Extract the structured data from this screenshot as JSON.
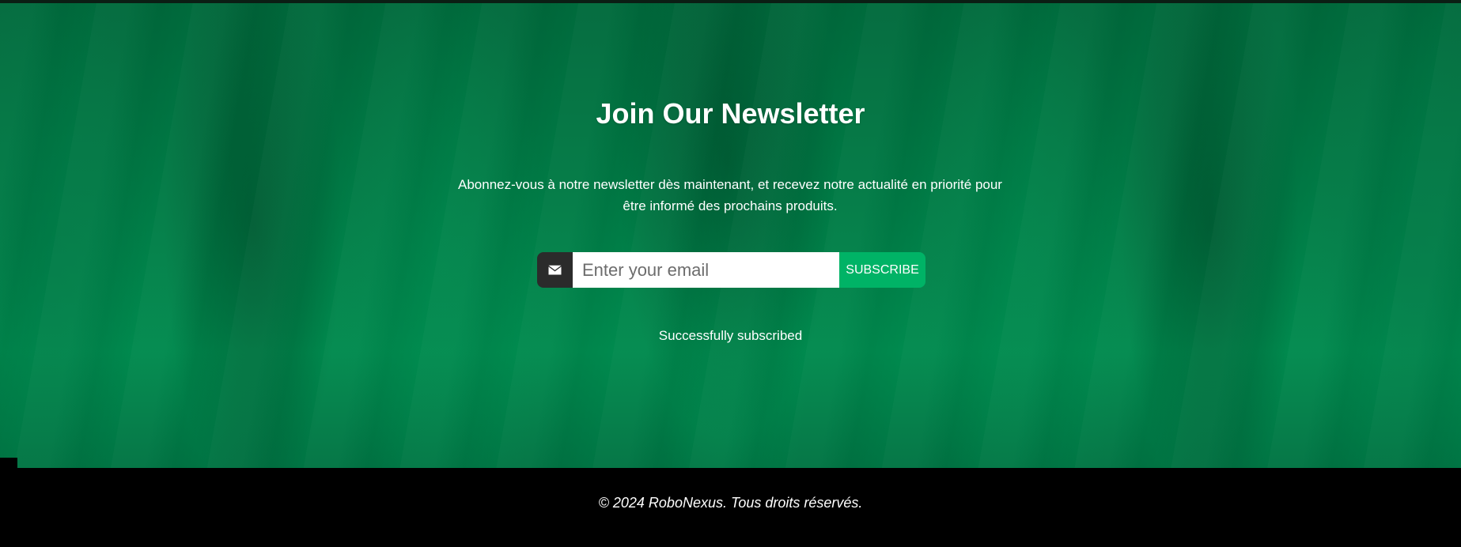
{
  "newsletter": {
    "title": "Join Our Newsletter",
    "description": "Abonnez-vous à notre newsletter dès maintenant, et recevez notre actualité en priorité pour être informé des prochains produits.",
    "email_placeholder": "Enter your email",
    "email_value": "",
    "subscribe_label": "SUBSCRIBE",
    "status_message": "Successfully subscribed",
    "icon": "envelope-icon"
  },
  "footer": {
    "copyright": "© 2024 RoboNexus. Tous droits réservés."
  },
  "colors": {
    "background_green": "#007a45",
    "subscribe_button": "#00b366",
    "icon_box": "#2b2b2b",
    "footer_bg": "#000000",
    "text": "#ffffff"
  }
}
